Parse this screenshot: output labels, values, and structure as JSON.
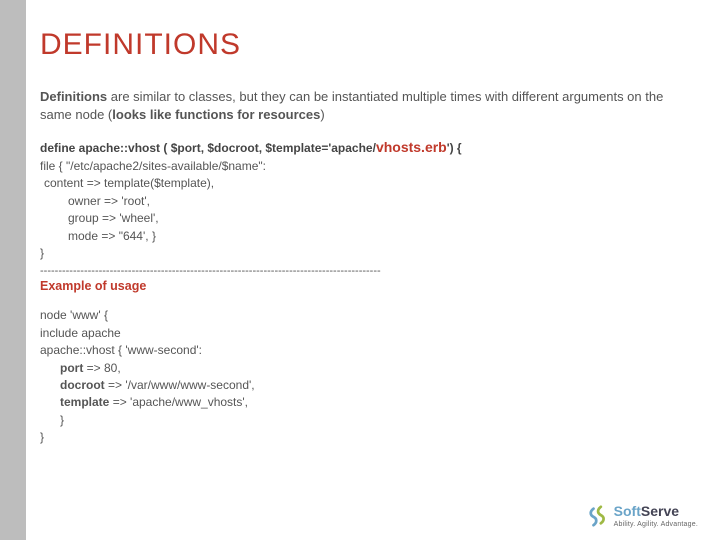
{
  "title": "DEFINITIONS",
  "intro": {
    "lead_bold": "Definitions",
    "text_1": " are similar to classes, but they can be instantiated multiple times with different arguments on the same node (",
    "tail_bold": "looks like functions for resources",
    "paren_close": ")"
  },
  "define": {
    "prefix": "define apache::vhost ( $port, $docroot, $template='apache/",
    "erb": "vhosts.erb",
    "suffix": "') {"
  },
  "code": {
    "l1": "file { \"/etc/apache2/sites-available/$name\":",
    "l2": " content => template($template),",
    "l3": "owner => 'root',",
    "l4": "group => 'wheel',",
    "l5": "mode => \"644', }",
    "l6": " }"
  },
  "divider": "---------------------------------------------------------------------------------------------",
  "example_header": "Example of usage",
  "usage": {
    "u1": "node 'www' {",
    "u2": "include apache",
    "u3": "apache::vhost { 'www-second':",
    "u4a_b": "port",
    "u4b": " => 80,",
    "u5a_b": "docroot",
    "u5b": " => '/var/www/www-second',",
    "u6a_b": "template",
    "u6b": " => 'apache/www_vhosts',",
    "u7": "}",
    "u8": "}"
  },
  "logo": {
    "brand_a": "Soft",
    "brand_b": "Serve",
    "tagline": "Ability. Agility. Advantage."
  }
}
